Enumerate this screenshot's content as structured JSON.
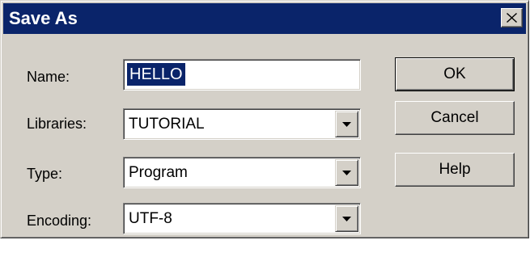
{
  "window": {
    "title": "Save As",
    "close_icon": "close-icon"
  },
  "form": {
    "name": {
      "label": "Name:",
      "value": "HELLO"
    },
    "libraries": {
      "label": "Libraries:",
      "value": "TUTORIAL",
      "icon": "chevron-down-icon"
    },
    "type": {
      "label": "Type:",
      "value": "Program",
      "icon": "chevron-down-icon"
    },
    "encoding": {
      "label": "Encoding:",
      "value": "UTF-8",
      "icon": "chevron-down-icon"
    }
  },
  "buttons": {
    "ok": "OK",
    "cancel": "Cancel",
    "help": "Help"
  },
  "colors": {
    "titlebar": "#0a246a",
    "face": "#d4d0c8",
    "selection": "#0a246a"
  }
}
